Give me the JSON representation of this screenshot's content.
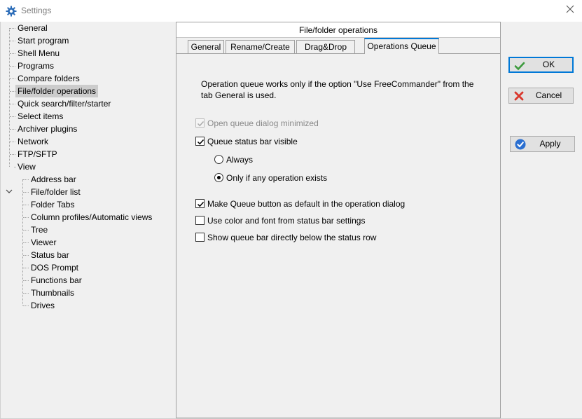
{
  "window": {
    "title": "Settings",
    "icon": "gear-icon",
    "close_icon": "close-icon"
  },
  "tree": {
    "items": [
      {
        "label": "General",
        "level": 0
      },
      {
        "label": "Start program",
        "level": 0
      },
      {
        "label": "Shell Menu",
        "level": 0
      },
      {
        "label": "Programs",
        "level": 0
      },
      {
        "label": "Compare folders",
        "level": 0
      },
      {
        "label": "File/folder operations",
        "level": 0,
        "selected": true
      },
      {
        "label": "Quick search/filter/starter",
        "level": 0
      },
      {
        "label": "Select items",
        "level": 0
      },
      {
        "label": "Archiver plugins",
        "level": 0
      },
      {
        "label": "Network",
        "level": 0
      },
      {
        "label": "FTP/SFTP",
        "level": 0
      },
      {
        "label": "View",
        "level": 0,
        "expanded": true
      },
      {
        "label": "Address bar",
        "level": 1
      },
      {
        "label": "File/folder list",
        "level": 1
      },
      {
        "label": "Folder Tabs",
        "level": 1
      },
      {
        "label": "Column profiles/Automatic views",
        "level": 1
      },
      {
        "label": "Tree",
        "level": 1
      },
      {
        "label": "Viewer",
        "level": 1
      },
      {
        "label": "Status bar",
        "level": 1
      },
      {
        "label": "DOS Prompt",
        "level": 1
      },
      {
        "label": "Functions bar",
        "level": 1
      },
      {
        "label": "Thumbnails",
        "level": 1
      },
      {
        "label": "Drives",
        "level": 1
      }
    ]
  },
  "panel": {
    "header": "File/folder operations",
    "tabs": [
      {
        "label": "General",
        "active": false
      },
      {
        "label": "Rename/Create",
        "active": false
      },
      {
        "label": "Drag&Drop",
        "active": false
      },
      {
        "label": "Operations Queue",
        "active": true
      }
    ],
    "info": "Operation queue works only if the option \"Use FreeCommander\" from the tab General is used.",
    "options": {
      "open_minimized": {
        "label": "Open queue dialog minimized",
        "checked": true,
        "disabled": true
      },
      "status_bar_visible": {
        "label": "Queue status bar visible",
        "checked": true
      },
      "radio_always": {
        "label": "Always",
        "selected": false
      },
      "radio_only_if": {
        "label": "Only if any operation exists",
        "selected": true
      },
      "make_default": {
        "label": "Make Queue button as default in the operation dialog",
        "checked": true
      },
      "use_color_font": {
        "label": "Use color and font from status bar settings",
        "checked": false
      },
      "show_below": {
        "label": "Show queue bar directly below the status row",
        "checked": false
      }
    }
  },
  "buttons": {
    "ok": {
      "label": "OK",
      "icon": "checkmark-icon",
      "color": "#3c9a3c"
    },
    "cancel": {
      "label": "Cancel",
      "icon": "x-icon",
      "color": "#d9362b"
    },
    "apply": {
      "label": "Apply",
      "icon": "check-circle-icon",
      "color": "#2a6fd1"
    }
  },
  "colors": {
    "selection": "#cccccc",
    "accent": "#0078d7"
  }
}
